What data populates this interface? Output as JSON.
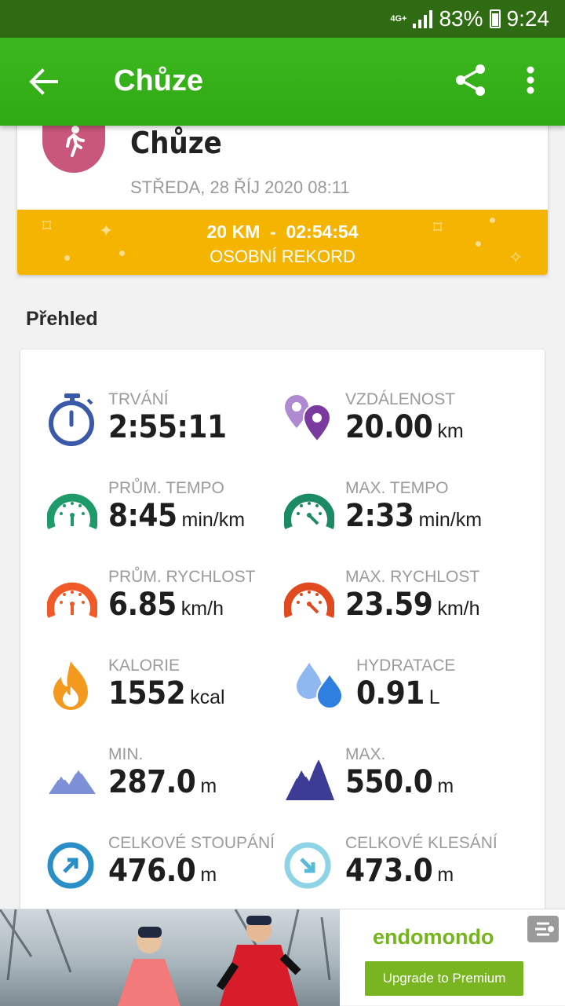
{
  "status_bar": {
    "network": "4G+",
    "battery": "83%",
    "time": "9:24"
  },
  "app_bar": {
    "title": "Chůze"
  },
  "activity": {
    "name": "Chůze",
    "date": "STŘEDA, 28 ŘÍJ 2020 08:11",
    "record_line1": "20 KM  -  02:54:54",
    "record_line2": "OSOBNÍ REKORD",
    "avatar_color": "#c8577b",
    "record_color": "#f4b400"
  },
  "overview": {
    "title": "Přehled",
    "stats": [
      {
        "icon": "stopwatch-icon",
        "label": "TRVÁNÍ",
        "value": "2:55:11",
        "unit": ""
      },
      {
        "icon": "location-pins-icon",
        "label": "VZDÁLENOST",
        "value": "20.00",
        "unit": "km"
      },
      {
        "icon": "avg-pace-gauge-icon",
        "label": "PRŮM. TEMPO",
        "value": "8:45",
        "unit": "min/km"
      },
      {
        "icon": "max-pace-gauge-icon",
        "label": "MAX. TEMPO",
        "value": "2:33",
        "unit": "min/km"
      },
      {
        "icon": "avg-speed-gauge-icon",
        "label": "PRŮM. RYCHLOST",
        "value": "6.85",
        "unit": "km/h"
      },
      {
        "icon": "max-speed-gauge-icon",
        "label": "MAX. RYCHLOST",
        "value": "23.59",
        "unit": "km/h"
      },
      {
        "icon": "flame-icon",
        "label": "KALORIE",
        "value": "1552",
        "unit": "kcal"
      },
      {
        "icon": "water-drops-icon",
        "label": "HYDRATACE",
        "value": "0.91",
        "unit": "L"
      },
      {
        "icon": "mountain-min-icon",
        "label": "MIN.",
        "value": "287.0",
        "unit": "m"
      },
      {
        "icon": "mountain-max-icon",
        "label": "MAX.",
        "value": "550.0",
        "unit": "m"
      },
      {
        "icon": "ascent-arrow-icon",
        "label": "CELKOVÉ STOUPÁNÍ",
        "value": "476.0",
        "unit": "m"
      },
      {
        "icon": "descent-arrow-icon",
        "label": "CELKOVÉ KLESÁNÍ",
        "value": "473.0",
        "unit": "m"
      }
    ]
  },
  "ad": {
    "brand": "endomondo",
    "button": "Upgrade to Premium"
  }
}
